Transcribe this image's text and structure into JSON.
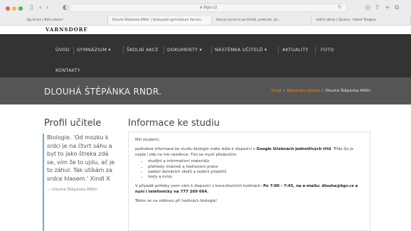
{
  "browser": {
    "url": "a bgv.cz",
    "tabs": [
      {
        "label": "Bg Srdce | Bílé srdeční"
      },
      {
        "label": "Dlouhá Štěpánka RNDr. | Biskupské gymnázium Varnsd..."
      },
      {
        "label": "Rozvoj sociál ní po litické, politické, str..."
      },
      {
        "label": "ediční obraz | Zpráva - Hádal Tengkev"
      }
    ]
  },
  "site": {
    "logo": "VARNSDORF"
  },
  "nav": {
    "items": [
      {
        "label": "ÚVOD"
      },
      {
        "label": "GYMNÁZIUM ▾"
      },
      {
        "label": "ŠKOLNÍ AKCE"
      },
      {
        "label": "DOKUMENTY ▾"
      },
      {
        "label": "NÁSTĚNKA UČITELŮ ▾"
      },
      {
        "label": "AKTUALITY"
      },
      {
        "label": "FOTO"
      },
      {
        "label": "KONTAKTY"
      }
    ]
  },
  "header": {
    "title": "DLOUHÁ ŠTĚPÁNKA RNDR.",
    "breadcrumb": {
      "home": "Úvod",
      "section": "Nástěnka učitelů",
      "current": "Dlouhá Štěpánka RNDr.",
      "separator": "/"
    }
  },
  "sidebar": {
    "title": "Profil učitele",
    "quote": "Biologie. 'Od mozku k srdci je na čtvrt sáhu a byt to jako štreka zdá se, vím že to ujdu, ač je to záhul. Tak utíkám za srdce hlasem.' Xindl X",
    "author": "— Dlouhá Štěpánka RNDr."
  },
  "main": {
    "title": "Informace ke studiu",
    "greeting": "Milí studenti,",
    "intro_before": "podrobné informace ke studiu biologie máte stále k dispozici v ",
    "intro_bold": "Google Učebnách jednotlivých tříd",
    "intro_after": ". Třída Gs je najde i zde na mé nástěnce. Tím se myslí především:",
    "bullets": [
      "studijní a informativní materiály",
      "přehledy známek a hodnocení práce",
      "zadání domácích úkolů a zadání projektů",
      "testy a kvízy"
    ],
    "contact_before": "V případě potřeby jsem vám k dispozici v konzultačních hodinách: ",
    "contact_hours": "Po 7:00 - 7:45, na e-mailu: dlouha@bgv.cz a nyní i telefonicky na 777 269 664.",
    "closing": "Těším se na viděnou při hodinách biologie!"
  }
}
